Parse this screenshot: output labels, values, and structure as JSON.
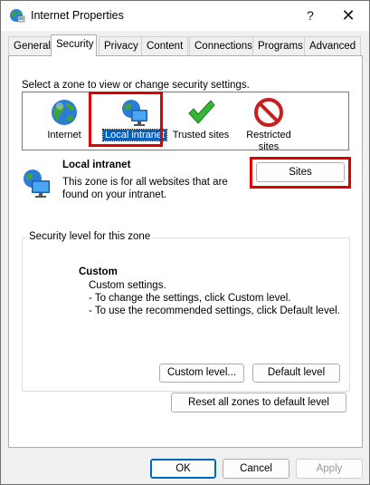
{
  "window": {
    "title": "Internet Properties",
    "help_glyph": "?",
    "close_glyph": "✕"
  },
  "tabs": [
    {
      "label": "General"
    },
    {
      "label": "Security"
    },
    {
      "label": "Privacy"
    },
    {
      "label": "Content"
    },
    {
      "label": "Connections"
    },
    {
      "label": "Programs"
    },
    {
      "label": "Advanced"
    }
  ],
  "active_tab": "Security",
  "security": {
    "select_zone_label": "Select a zone to view or change security settings.",
    "zones": [
      {
        "label": "Internet",
        "icon": "globe-icon"
      },
      {
        "label": "Local intranet",
        "icon": "intranet-monitor-icon",
        "selected": true
      },
      {
        "label": "Trusted sites",
        "icon": "check-mark-icon"
      },
      {
        "label_line1": "Restricted",
        "label_line2": "sites",
        "icon": "restricted-icon"
      }
    ],
    "zone_info": {
      "title": "Local intranet",
      "description": "This zone is for all websites that are found on your intranet."
    },
    "sites_button": "Sites",
    "security_level": {
      "legend": "Security level for this zone",
      "level_title": "Custom",
      "lines": [
        "Custom settings.",
        "- To change the settings, click Custom level.",
        "- To use the recommended settings, click Default level."
      ],
      "custom_level_button": "Custom level...",
      "default_level_button": "Default level"
    },
    "reset_all_button": "Reset all zones to default level"
  },
  "footer": {
    "ok": "OK",
    "cancel": "Cancel",
    "apply": "Apply"
  },
  "colors": {
    "highlight": "#e00000",
    "selection": "#0060c0"
  }
}
